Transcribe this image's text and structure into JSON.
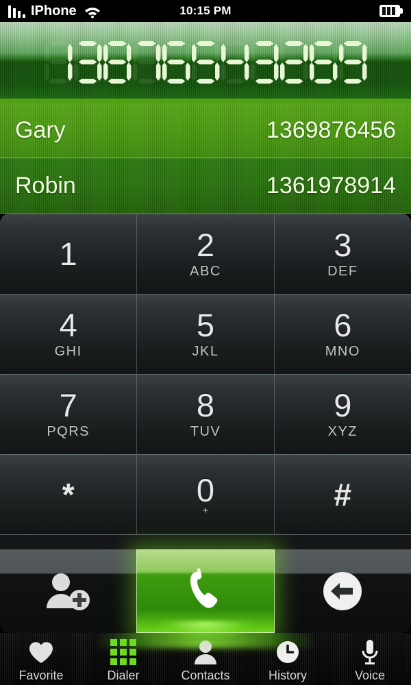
{
  "status_bar": {
    "carrier": "IPhone",
    "time": "10:15 PM",
    "signal_icon": "signal-bars-icon",
    "wifi_icon": "wifi-icon",
    "battery_icon": "battery-icon"
  },
  "display": {
    "number": "13876543269",
    "digits": [
      "1",
      "3",
      "8",
      "7",
      "6",
      "5",
      "4",
      "3",
      "2",
      "6",
      "9"
    ]
  },
  "suggestions": [
    {
      "name": "Gary",
      "number": "1369876456",
      "highlighted": true
    },
    {
      "name": "Robin",
      "number": "1361978914",
      "highlighted": false
    }
  ],
  "keypad": {
    "rows": [
      [
        {
          "digit": "1",
          "letters": ""
        },
        {
          "digit": "2",
          "letters": "ABC"
        },
        {
          "digit": "3",
          "letters": "DEF"
        }
      ],
      [
        {
          "digit": "4",
          "letters": "GHI"
        },
        {
          "digit": "5",
          "letters": "JKL"
        },
        {
          "digit": "6",
          "letters": "MNO"
        }
      ],
      [
        {
          "digit": "7",
          "letters": "PQRS"
        },
        {
          "digit": "8",
          "letters": "TUV"
        },
        {
          "digit": "9",
          "letters": "XYZ"
        }
      ],
      [
        {
          "digit": "*",
          "letters": ""
        },
        {
          "digit": "0",
          "letters": "+"
        },
        {
          "digit": "#",
          "letters": ""
        }
      ]
    ]
  },
  "actions": {
    "add_contact_icon": "add-contact-icon",
    "call_icon": "call-handset-icon",
    "backspace_icon": "backspace-arrow-icon"
  },
  "tabbar": {
    "items": [
      {
        "label": "Favorite",
        "icon": "heart-icon",
        "active": false
      },
      {
        "label": "Dialer",
        "icon": "keypad-grid-icon",
        "active": true
      },
      {
        "label": "Contacts",
        "icon": "person-icon",
        "active": false
      },
      {
        "label": "History",
        "icon": "clock-icon",
        "active": false
      },
      {
        "label": "Voice",
        "icon": "microphone-icon",
        "active": false
      }
    ]
  },
  "colors": {
    "accent_green": "#4e9c10",
    "call_green": "#3f9c10",
    "lcd_digit": "#e9f6d6",
    "keypad_dark": "#1a1d1e",
    "tab_active": "#6ddb22"
  }
}
